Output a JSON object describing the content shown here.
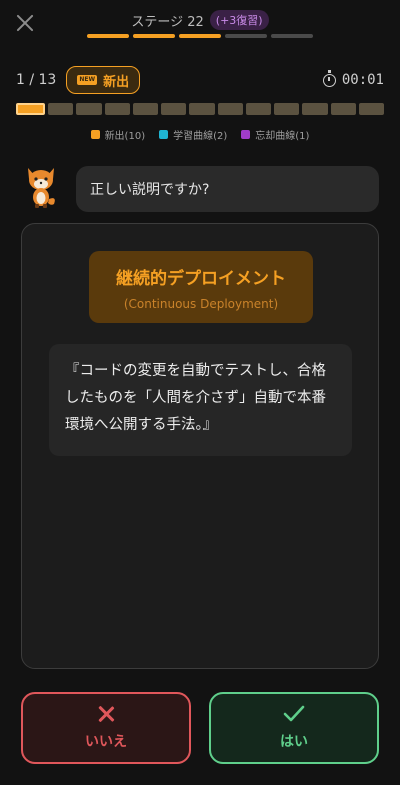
{
  "header": {
    "stage_title": "ステージ 22",
    "review_badge": "(+3復習)",
    "stage_segments": [
      "done",
      "done",
      "done",
      "todo",
      "todo"
    ]
  },
  "status": {
    "counter": "1 / 13",
    "new_icon_text": "NEW",
    "new_label": "新出",
    "timer": "00:01"
  },
  "progress": {
    "total": 13,
    "current_index": 0
  },
  "legend": [
    {
      "label": "新出(10)",
      "color": "#f5a023"
    },
    {
      "label": "学習曲線(2)",
      "color": "#1fb4d1"
    },
    {
      "label": "忘却曲線(1)",
      "color": "#a03cc9"
    }
  ],
  "question": {
    "prompt": "正しい説明ですか?"
  },
  "card": {
    "term": "継続的デプロイメント",
    "term_english": "(Continuous Deployment)",
    "description": "『コードの変更を自動でテストし、合格したものを「人間を介さず」自動で本番環境へ公開する手法。』"
  },
  "actions": {
    "no_label": "いいえ",
    "yes_label": "はい"
  },
  "colors": {
    "accent": "#f5a023",
    "no": "#e0575b",
    "yes": "#5fcf8b"
  }
}
